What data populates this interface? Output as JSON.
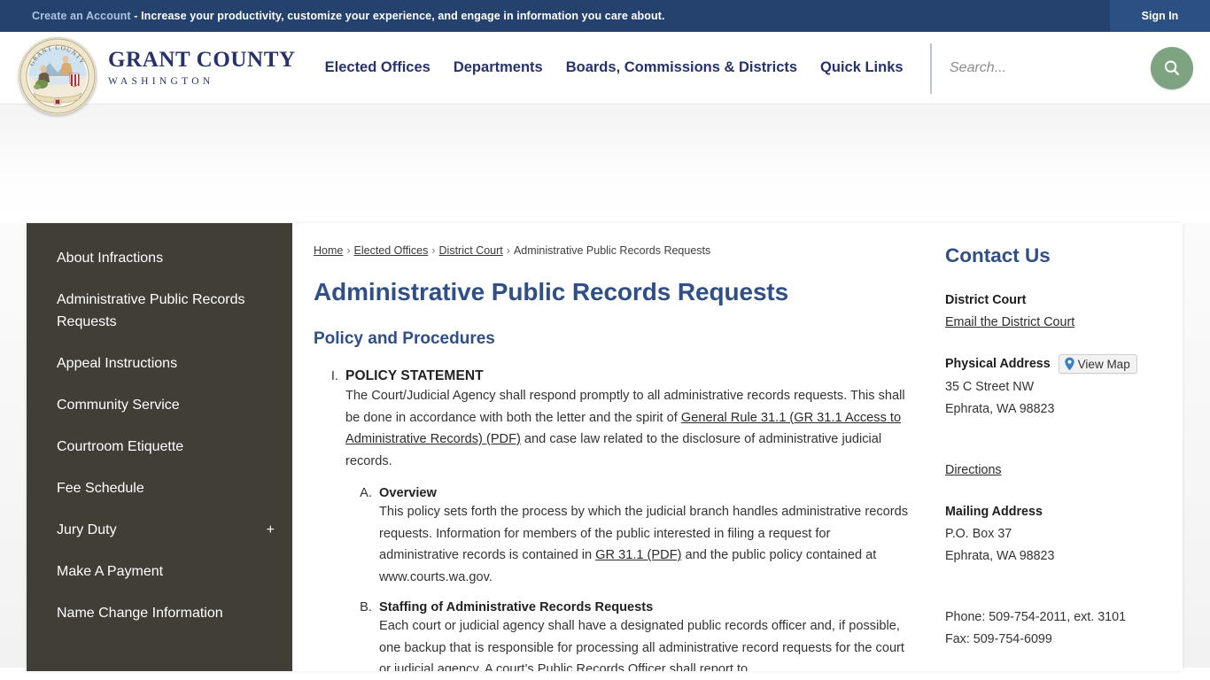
{
  "topbar": {
    "account_link": "Create an Account",
    "message": " - Increase your productivity, customize your experience, and engage in information you care about.",
    "signin_label": "Sign In"
  },
  "header": {
    "brand_name": "GRANT COUNTY",
    "brand_sub": "WASHINGTON",
    "seal_top_text": "GRANT COUNTY",
    "nav": [
      {
        "label": "Elected Offices"
      },
      {
        "label": "Departments"
      },
      {
        "label": "Boards, Commissions & Districts"
      },
      {
        "label": "Quick Links"
      }
    ],
    "search": {
      "placeholder": "Search...",
      "value": "",
      "button_icon": "search-icon"
    }
  },
  "sidebar": {
    "items": [
      {
        "label": "About Infractions",
        "expandable": false
      },
      {
        "label": "Administrative Public Records Requests",
        "expandable": false
      },
      {
        "label": "Appeal Instructions",
        "expandable": false
      },
      {
        "label": "Community Service",
        "expandable": false
      },
      {
        "label": "Courtroom Etiquette",
        "expandable": false
      },
      {
        "label": "Fee Schedule",
        "expandable": false
      },
      {
        "label": "Jury Duty",
        "expandable": true,
        "expander": "+"
      },
      {
        "label": "Make A Payment",
        "expandable": false
      },
      {
        "label": "Name Change Information",
        "expandable": false
      }
    ]
  },
  "breadcrumb": {
    "items": [
      {
        "label": "Home",
        "link": true
      },
      {
        "label": "Elected Offices",
        "link": true
      },
      {
        "label": "District Court",
        "link": true
      },
      {
        "label": "Administrative Public Records Requests",
        "link": false
      }
    ],
    "separator": "›"
  },
  "main": {
    "title": "Administrative Public Records Requests",
    "subtitle": "Policy and Procedures",
    "section1": {
      "marker": "I.",
      "heading": "POLICY STATEMENT",
      "text_1": "The Court/Judicial Agency shall respond promptly to all administrative records requests. This shall be done in accordance with both the letter and the spirit of ",
      "link_1": "General Rule 31.1 (GR 31.1 Access to Administrative Records) (PDF)",
      "text_2": " and case law related to the disclosure of administrative judicial records.",
      "subsections": [
        {
          "marker": "A.",
          "heading": "Overview",
          "text_1": "This policy sets forth the process by which the judicial branch handles administrative records requests. Information for members of the public interested in filing a request for administrative records is contained in ",
          "link_1": "GR 31.1 (PDF)",
          "text_2": " and the public policy contained at www.courts.wa.gov."
        },
        {
          "marker": "B.",
          "heading": "Staffing of Administrative Records Requests",
          "text_1": "Each court or judicial agency shall have a designated public records officer and, if possible, one backup that is responsible for processing all administrative record requests for the court or judicial agency. A court’s Public Records Officer shall report to",
          "link_1": "",
          "text_2": ""
        }
      ]
    }
  },
  "contact": {
    "heading": "Contact Us",
    "org": "District Court",
    "email_link": "Email the District Court",
    "physical_label": "Physical Address",
    "view_map_label": "View Map",
    "view_map_icon": "map-pin-icon",
    "physical_line1": "35 C Street NW",
    "physical_line2": "Ephrata, WA 98823",
    "directions_link": "Directions",
    "mailing_label": "Mailing Address",
    "mailing_line1": "P.O. Box 37",
    "mailing_line2": "Ephrata, WA 98823",
    "phone": "Phone: 509-754-2011, ext. 3101",
    "fax": "Fax: 509-754-6099"
  },
  "colors": {
    "topbar": "#24426d",
    "brand": "#27326b",
    "heading": "#2f4f86",
    "sidebar": "#413d37",
    "search_button": "#7da380",
    "map_pin": "#3b82c4"
  }
}
